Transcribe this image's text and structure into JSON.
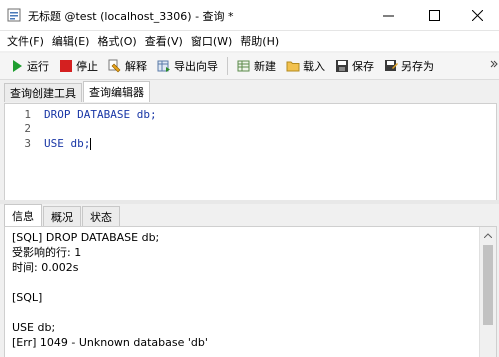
{
  "window": {
    "title": "无标题 @test (localhost_3306) - 查询 *"
  },
  "menu": [
    "文件(F)",
    "编辑(E)",
    "格式(O)",
    "查看(V)",
    "窗口(W)",
    "帮助(H)"
  ],
  "toolbar": {
    "run": "运行",
    "stop": "停止",
    "explain": "解释",
    "export_wizard": "导出向导",
    "new": "新建",
    "load": "载入",
    "save": "保存",
    "save_as": "另存为"
  },
  "subtabs": [
    "查询创建工具",
    "查询编辑器"
  ],
  "editor": {
    "line_numbers": [
      "1",
      "2",
      "3"
    ],
    "lines": [
      "DROP DATABASE db;",
      "",
      "USE db;"
    ]
  },
  "result_tabs": [
    "信息",
    "概况",
    "状态"
  ],
  "output_lines": [
    "[SQL] DROP DATABASE db;",
    "受影响的行: 1",
    "时间: 0.002s",
    "",
    "[SQL]",
    "",
    "USE db;",
    "[Err] 1049 - Unknown database 'db'"
  ],
  "colors": {
    "run_green": "#1e9e2f",
    "stop_red": "#d42020",
    "code_blue": "#1a37a6"
  }
}
